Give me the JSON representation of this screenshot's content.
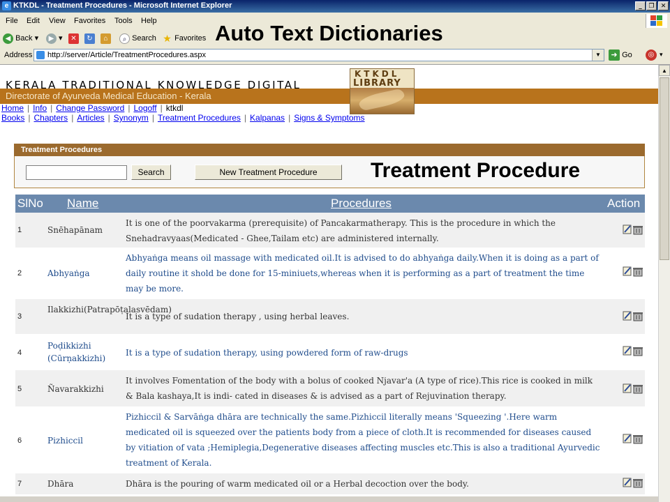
{
  "window": {
    "title": "KTKDL - Treatment Procedures - Microsoft Internet Explorer",
    "overlay_title": "Auto Text Dictionaries"
  },
  "menu": [
    "File",
    "Edit",
    "View",
    "Favorites",
    "Tools",
    "Help"
  ],
  "toolbar": {
    "back_label": "Back",
    "search_label": "Search",
    "favorites_label": "Favorites"
  },
  "address": {
    "label": "Address",
    "url": "http://server/Article/TreatmentProcedures.aspx",
    "go_label": "Go"
  },
  "site": {
    "title": "KERALA TRADITIONAL KNOWLEDGE DIGITAL",
    "org": "Directorate of Ayurveda Medical Education - Kerala",
    "logo_line1": "KTKDL",
    "logo_line2": "LIBRARY"
  },
  "nav": {
    "home": "Home",
    "info": "Info",
    "change_password": "Change Password",
    "logoff": "Logoff",
    "user": "ktkdl",
    "books": "Books",
    "chapters": "Chapters",
    "articles": "Articles",
    "synonym": "Synonym",
    "treatment_procedures": "Treatment Procedures",
    "kalpanas": "Kalpanas",
    "signs_symptoms": "Signs & Symptoms"
  },
  "panel": {
    "heading": "Treatment Procedures",
    "search_value": "",
    "search_button": "Search",
    "new_button": "New Treatment Procedure",
    "section_title": "Treatment Procedure"
  },
  "table": {
    "headers": {
      "slno": "SlNo",
      "name": "Name",
      "procedures": "Procedures",
      "action": "Action"
    },
    "rows": [
      {
        "slno": "1",
        "name": "Snēhapānam",
        "procedure": "It is one of the poorvakarma (prerequisite) of Pancakarmatherapy. This is the procedure in which the Snehadravyaas(Medicated - Ghee,Tailam etc) are administered internally."
      },
      {
        "slno": "2",
        "name": "Abhyaṅga",
        "procedure": "Abhyaṅga means oil massage with medicated oil.It is advised to do abhyaṅga daily.When it is doing as a part of daily routine it shold be done for 15-miniuets,whereas when it is performing as a part of treatment the time may be more."
      },
      {
        "slno": "3",
        "name": "Ilakkizhi(Patrapōṭalasvēdam)",
        "procedure": "It is a type of sudation therapy , using herbal leaves."
      },
      {
        "slno": "4",
        "name": "Poḍikkizhi (Cūrṇakkizhi)",
        "procedure": "It is a type of sudation therapy, using powdered form of raw-drugs"
      },
      {
        "slno": "5",
        "name": "Ñavarakkizhi",
        "procedure": "It involves Fomentation of the body with a bolus of cooked Njavar'a (A type of rice).This rice is cooked in milk & Bala kashaya,It is indi- cated in diseases & is advised as a part of Rejuvination therapy."
      },
      {
        "slno": "6",
        "name": "Pizhiccil",
        "procedure": "Pizhiccil & Sarvāṅga dhāra are technically the same.Pizhiccil literally means 'Squeezing '.Here warm medicated oil is squeezed over the patients body from a piece of cloth.It is recommended for diseases caused by vitiation of vata ;Hemiplegia,Degenerative diseases affecting muscles etc.This is also a traditional Ayurvedic treatment of Kerala."
      },
      {
        "slno": "7",
        "name": "Dhāra",
        "procedure": "Dhāra is the pouring of warm medicated oil or a Herbal decoction over the body."
      }
    ]
  },
  "colors": {
    "header_bar": "#b8731c",
    "panel_head": "#9b6a2e",
    "table_head": "#6b89ad",
    "link": "#0000ee"
  }
}
